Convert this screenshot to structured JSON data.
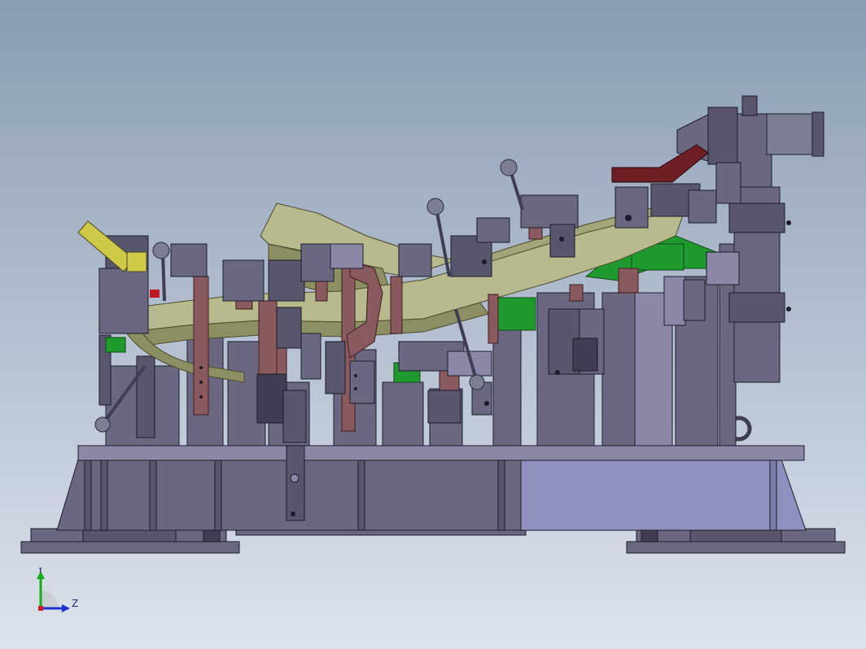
{
  "view": {
    "background_top": "#8a9cb3",
    "background_bottom": "#dde3ec"
  },
  "palette": {
    "body": "#6a6880",
    "body_light": "#8a88a6",
    "body_dark": "#3f3e52",
    "base_highlight": "#8f8fc0",
    "outline": "#1c1c2a",
    "part_olive": "#b8b98c",
    "part_olive_dark": "#8d8e62",
    "clamp_brown": "#8a5a5e",
    "clamp_red": "#6e1e24",
    "locator_green": "#1f9a2e",
    "handle_yellow": "#cfc94a",
    "knob_gray": "#7c7e92"
  },
  "triad": {
    "y_label": "Y",
    "z_label": "Z",
    "x_color": "#d01818",
    "y_color": "#18a818",
    "z_color": "#1c2fd0"
  }
}
